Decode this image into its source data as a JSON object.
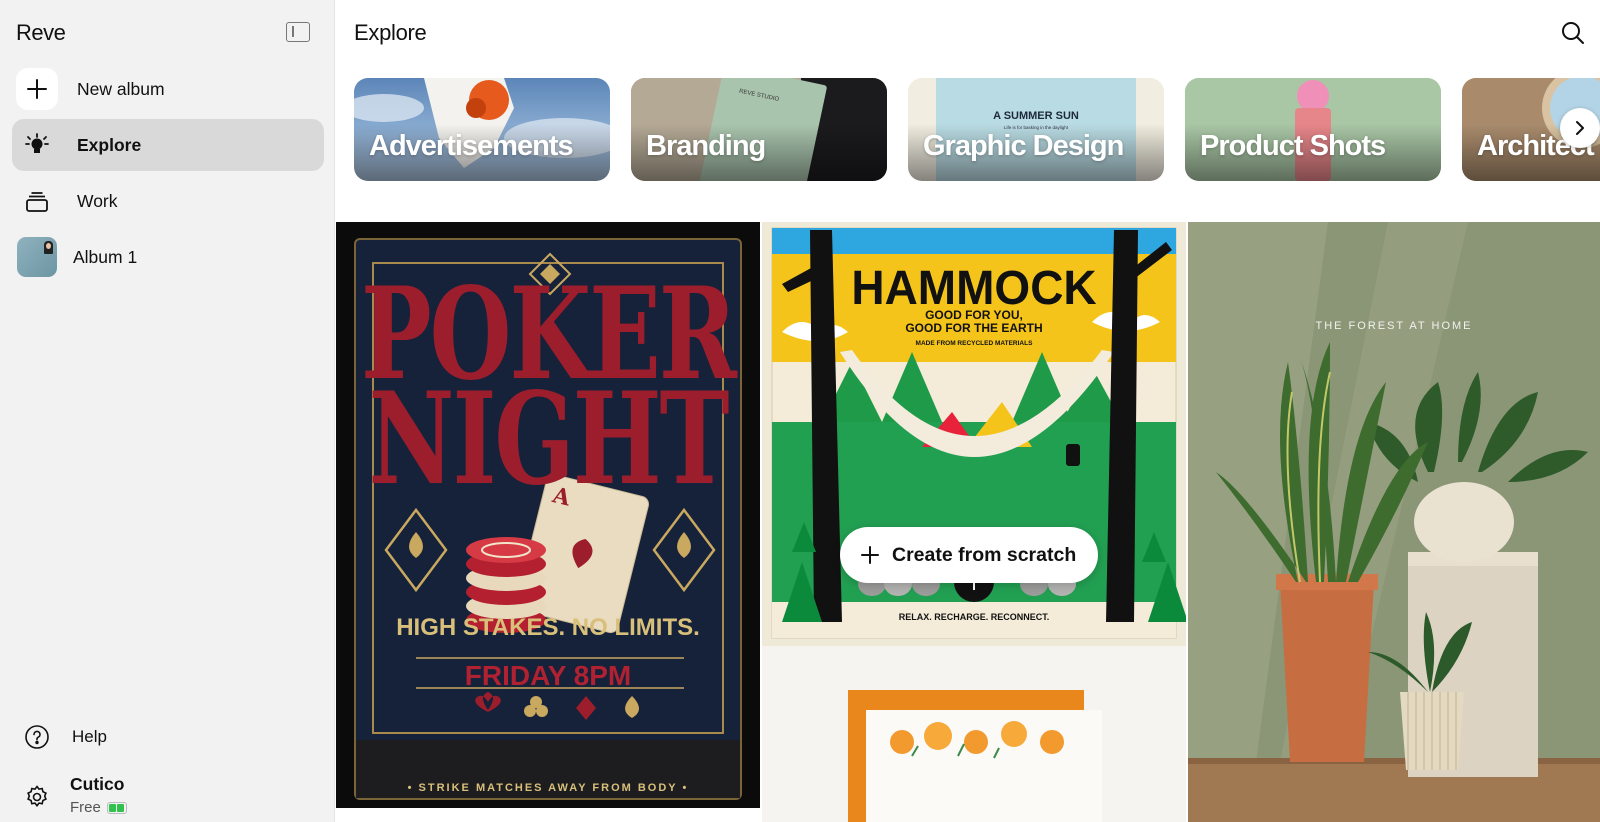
{
  "app": {
    "brand": "Reve"
  },
  "sidebar": {
    "items": [
      {
        "label": "New album",
        "icon": "plus-icon"
      },
      {
        "label": "Explore",
        "icon": "lightbulb-icon",
        "active": true
      },
      {
        "label": "Work",
        "icon": "stack-icon"
      },
      {
        "label": "Album 1",
        "icon": "album-thumbnail"
      }
    ],
    "help": "Help",
    "user": {
      "name": "Cutico",
      "plan": "Free"
    }
  },
  "main": {
    "title": "Explore",
    "categories": [
      {
        "label": "Advertisements"
      },
      {
        "label": "Branding"
      },
      {
        "label": "Graphic Design"
      },
      {
        "label": "Product Shots"
      },
      {
        "label": "Architect"
      }
    ],
    "category_card_text": {
      "branding_book": "REVE STUDIO",
      "graphic_design": "A SUMMER SUN",
      "graphic_design_small": "Life is for basking in the daylight"
    },
    "gallery": {
      "poker": {
        "line1": "POKER",
        "line2": "NIGHT",
        "tagline": "HIGH STAKES. NO LIMITS.",
        "when": "FRIDAY 8PM",
        "footer": "• STRIKE  MATCHES  AWAY FROM BODY •"
      },
      "hammock": {
        "title": "HAMMOCK",
        "line1": "GOOD FOR YOU,",
        "line2": "GOOD FOR THE EARTH",
        "line3": "MADE FROM RECYCLED MATERIALS",
        "footer": "RELAX. RECHARGE. RECONNECT."
      },
      "plant": {
        "title": "THE FOREST AT HOME"
      }
    },
    "create_button": "Create from scratch"
  },
  "colors": {
    "sidebar_bg": "#f2f2f2",
    "active_item_bg": "#d9d9d9",
    "battery_green": "#2fc24e"
  }
}
